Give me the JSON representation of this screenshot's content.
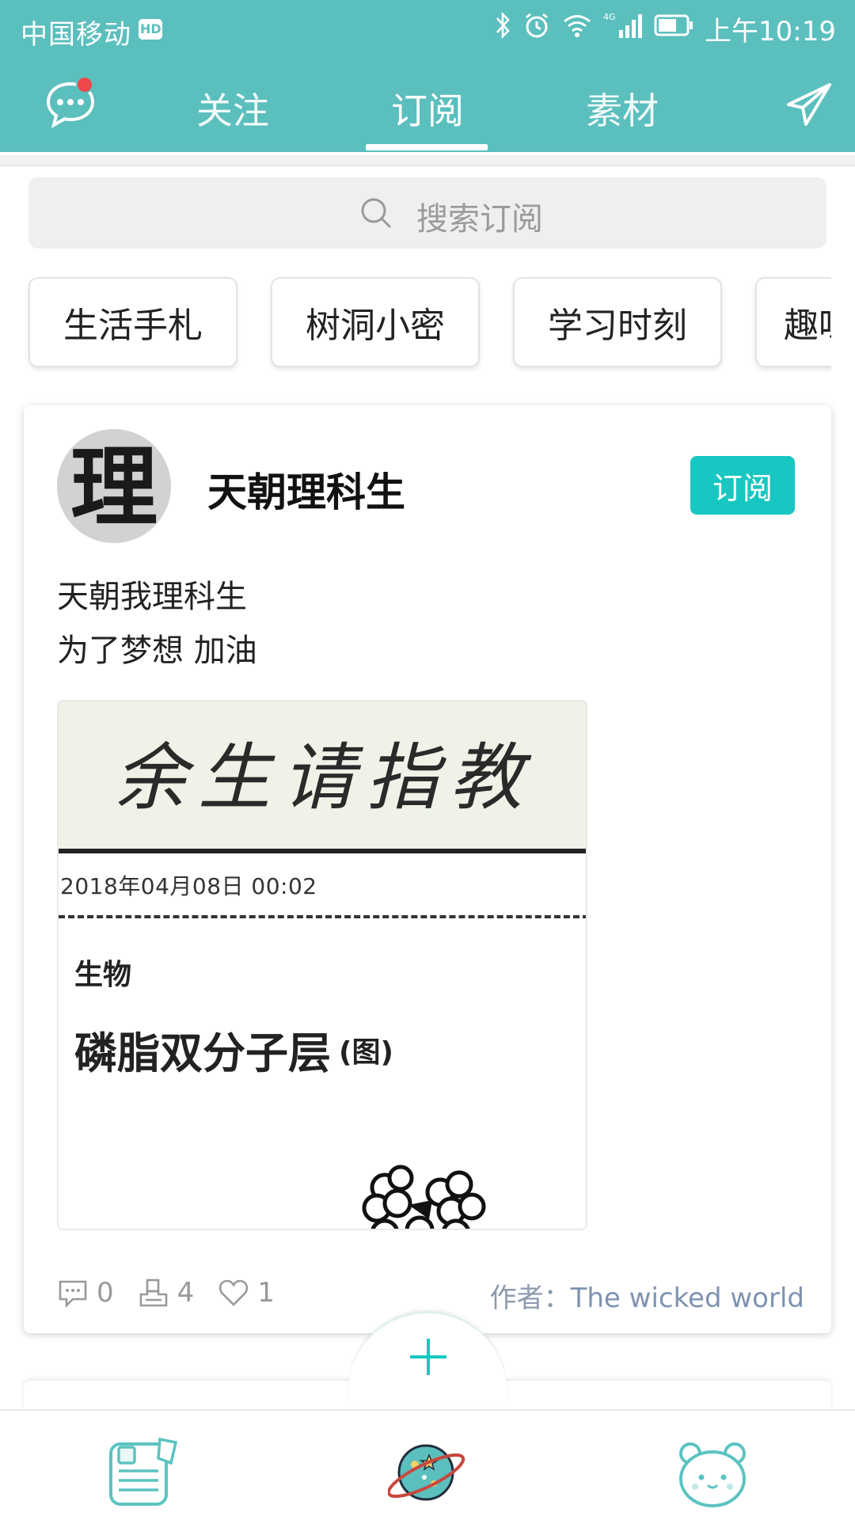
{
  "status_bar": {
    "carrier": "中国移动",
    "hd_badge": "HD",
    "network": "4G",
    "time": "上午10:19"
  },
  "nav": {
    "tabs": [
      {
        "label": "关注",
        "active": false
      },
      {
        "label": "订阅",
        "active": true
      },
      {
        "label": "素材",
        "active": false
      }
    ],
    "message_has_badge": true
  },
  "search": {
    "placeholder": "搜索订阅"
  },
  "categories": [
    "生活手札",
    "树洞小密",
    "学习时刻",
    "趣味"
  ],
  "card": {
    "name": "天朝理科生",
    "subscribe_label": "订阅",
    "description": [
      "天朝我理科生",
      "为了梦想 加油"
    ],
    "image": {
      "calligraphy": "余生请指教",
      "date": "2018年04月08日   00:02",
      "subject": "生物",
      "topic": "磷脂双分子层",
      "topic_suffix": "(图)"
    },
    "stats": {
      "comments": "0",
      "reposts": "4",
      "likes": "1"
    },
    "author_label": "作者：",
    "author_name": "The wicked world",
    "avatar_char": "理"
  },
  "colors": {
    "header": "#5BBFBE",
    "accent": "#18C7C1",
    "badge": "#F04848"
  }
}
